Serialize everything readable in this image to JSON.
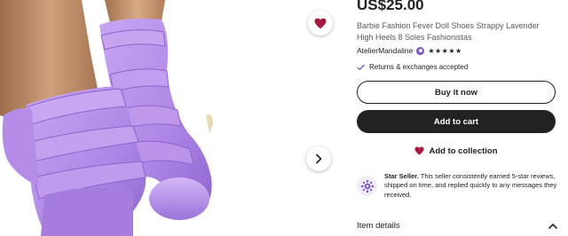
{
  "listing": {
    "price": "US$25.00",
    "title": "Barbie Fashion Fever Doll Shoes Strappy Lavender High Heels 8 Soles Fashionistas",
    "seller_name": "AtelierMandaline",
    "rating_stars": "★★★★★",
    "rating": 5,
    "returns": "Returns & exchanges accepted"
  },
  "actions": {
    "buy_now": "Buy it now",
    "add_to_cart": "Add to cart",
    "add_to_collection": "Add to collection"
  },
  "star_seller": {
    "heading": "Star Seller.",
    "body": "This seller consistently earned 5-star reviews, shipped on time, and replied quickly to any messages they received."
  },
  "details": {
    "label": "Item details"
  },
  "icons": {
    "favorite": "heart-icon",
    "next": "chevron-right-icon",
    "seller_badge": "star-seller-badge-icon",
    "returns": "checkmark-icon",
    "collection": "heart-icon",
    "star_seller": "star-seller-icon",
    "details_toggle": "chevron-up-icon"
  },
  "colors": {
    "accent_heart": "#a61a3f",
    "primary_button": "#222222",
    "star_seller_purple": "#7b4fc9",
    "shoe_lavender": "#b48ee8",
    "skin": "#c99a77"
  }
}
